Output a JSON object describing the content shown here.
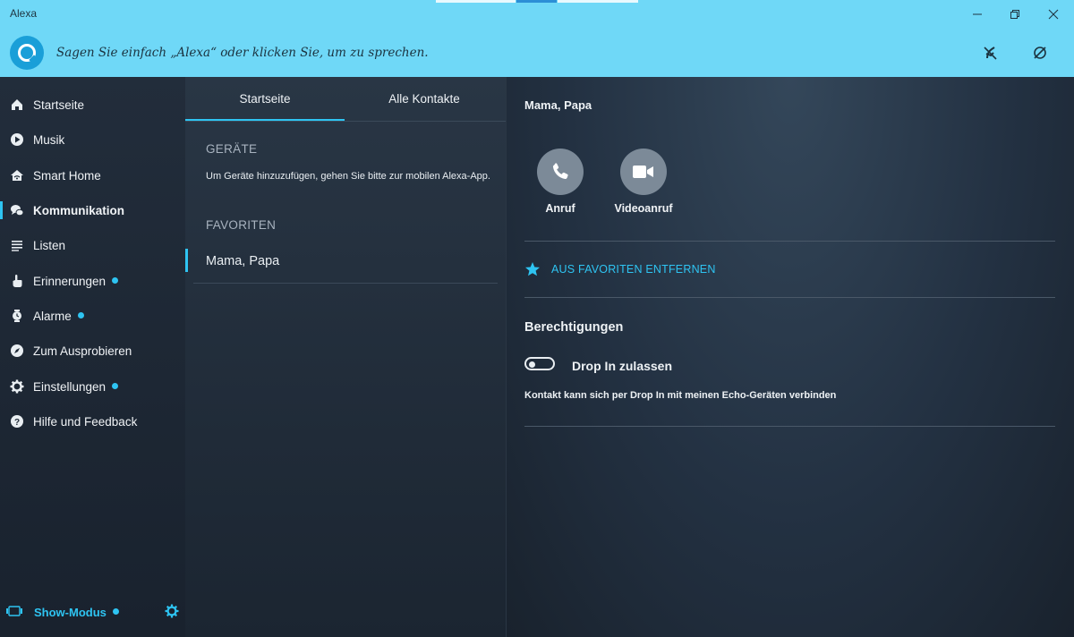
{
  "window": {
    "title": "Alexa"
  },
  "header": {
    "prompt": "Sagen Sie einfach „Alexa“ oder klicken Sie, um zu sprechen."
  },
  "sidebar": {
    "items": [
      {
        "label": "Startseite",
        "icon": "home-icon"
      },
      {
        "label": "Musik",
        "icon": "play-icon"
      },
      {
        "label": "Smart Home",
        "icon": "smart-home-icon"
      },
      {
        "label": "Kommunikation",
        "icon": "chat-icon",
        "active": true
      },
      {
        "label": "Listen",
        "icon": "list-icon"
      },
      {
        "label": "Erinnerungen",
        "icon": "hand-icon",
        "dot": true
      },
      {
        "label": "Alarme",
        "icon": "alarm-icon",
        "dot": true
      },
      {
        "label": "Zum Ausprobieren",
        "icon": "compass-icon"
      },
      {
        "label": "Einstellungen",
        "icon": "gear-icon",
        "dot": true
      },
      {
        "label": "Hilfe und Feedback",
        "icon": "help-icon"
      }
    ],
    "show_mode": {
      "label": "Show-Modus",
      "dot": true
    }
  },
  "middle": {
    "tabs": [
      {
        "label": "Startseite",
        "active": true
      },
      {
        "label": "Alle Kontakte"
      }
    ],
    "devices_heading": "GERÄTE",
    "devices_info": "Um Geräte hinzuzufügen, gehen Sie bitte zur mobilen Alexa-App.",
    "favorites_heading": "FAVORITEN",
    "favorites": [
      {
        "name": "Mama, Papa"
      }
    ]
  },
  "detail": {
    "contact_name": "Mama, Papa",
    "actions": [
      {
        "label": "Anruf",
        "icon": "phone-icon"
      },
      {
        "label": "Videoanruf",
        "icon": "video-camera-icon"
      }
    ],
    "favorite_link": "AUS FAVORITEN ENTFERNEN",
    "permissions_title": "Berechtigungen",
    "drop_in_label": "Drop In zulassen",
    "drop_in_enabled": false,
    "drop_in_description": "Kontakt kann sich per Drop In mit meinen Echo-Geräten verbinden"
  },
  "colors": {
    "accent": "#2ec4f2",
    "header_bg": "#6fd8f7",
    "sidebar_bg": "#1f2a37",
    "content_bg": "#233142"
  }
}
